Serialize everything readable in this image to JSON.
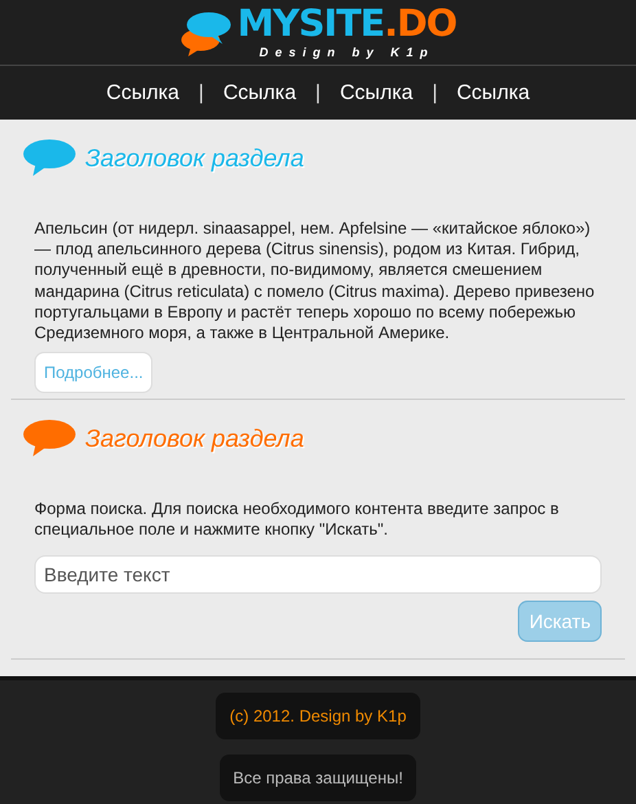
{
  "logo": {
    "parts": [
      {
        "text": "MYSITE",
        "color": "#1ab8ea"
      },
      {
        "text": ".DO",
        "color": "#ff6d00"
      }
    ],
    "tagline": "Design by K1p"
  },
  "nav": [
    {
      "kind": "link",
      "text": "Ссылка"
    },
    {
      "kind": "separator",
      "text": "|"
    },
    {
      "kind": "link",
      "text": "Ссылка"
    },
    {
      "kind": "separator",
      "text": "|"
    },
    {
      "kind": "link",
      "text": "Ссылка"
    },
    {
      "kind": "separator",
      "text": "|"
    },
    {
      "kind": "link",
      "text": "Ссылка"
    }
  ],
  "sections": [
    {
      "kind": "article",
      "color": "#1ab8ea",
      "title": "Заголовок раздела",
      "text": "Апельсин (от нидерл. sinaasappel, нем. Apfelsine — «китайское яблоко») — плод апельсинного дерева (Citrus sinensis), родом из Китая. Гибрид, полученный ещё в древности, по-видимому, является смешением мандарина (Citrus reticulata) с помело (Citrus maxima). Дерево привезено португальцами в Европу и растёт теперь хорошо по всему побережью Средиземного моря, а также в Центральной Америке.",
      "button": "Подробнее..."
    },
    {
      "kind": "search",
      "color": "#ff6d00",
      "title": "Заголовок раздела",
      "text": "Форма поиска. Для поиска необходимого контента введите запрос в специальное поле и нажмите кнопку \"Искать\".",
      "placeholder": "Введите текст",
      "button": "Искать"
    }
  ],
  "footer": {
    "copyright": "(c) 2012. Design by K1p",
    "rights": "Все права защищены!"
  }
}
